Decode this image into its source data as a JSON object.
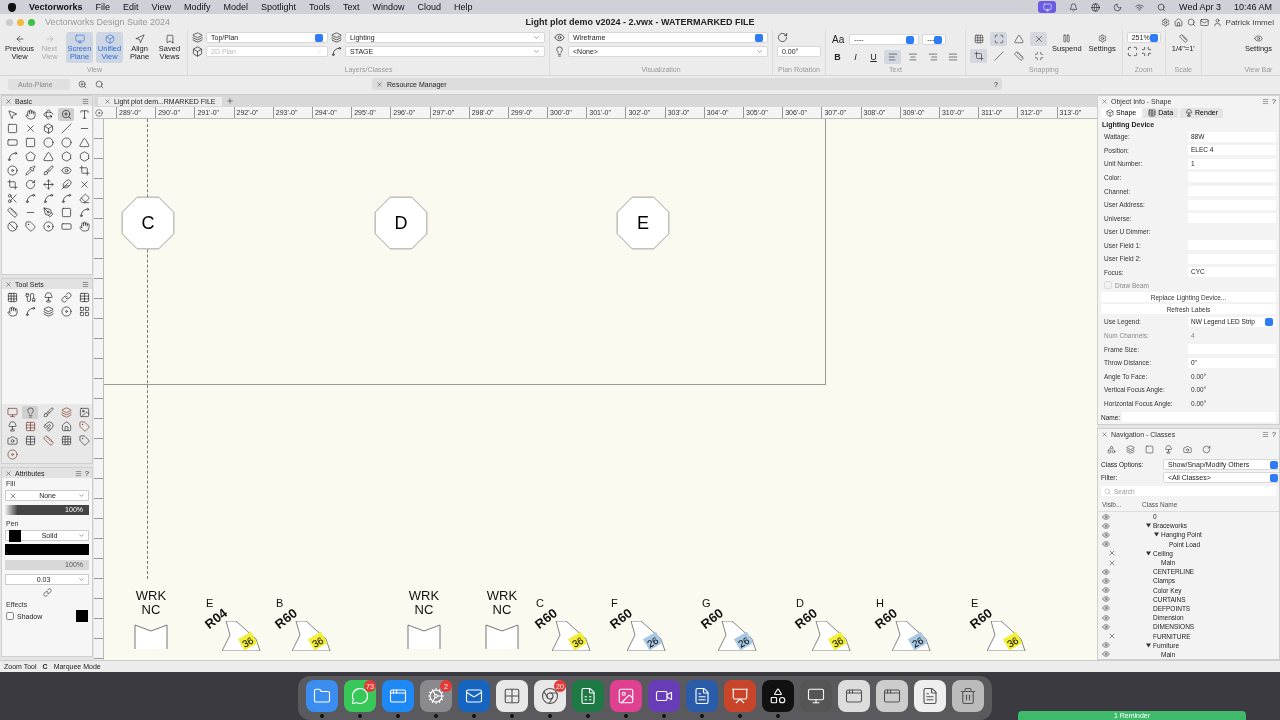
{
  "menu_bar": {
    "app": "Vectorworks",
    "menus": [
      "File",
      "Edit",
      "View",
      "Modify",
      "Model",
      "Spotlight",
      "Tools",
      "Text",
      "Window",
      "Cloud",
      "Help"
    ],
    "date": "Wed Apr 3",
    "time": "10:46 AM"
  },
  "window": {
    "app_title": "Vectorworks Design Suite 2024",
    "title": "Light plot demo v2024 - 2.vwx - WATERMARKED FILE",
    "user": "Patrick Immel"
  },
  "toolbar": {
    "view_buttons": [
      {
        "label": "Previous View",
        "selected": false,
        "disabled": false
      },
      {
        "label": "Next View",
        "selected": false,
        "disabled": true
      },
      {
        "label": "Screen Plane",
        "selected": true,
        "disabled": false
      },
      {
        "label": "Unified View",
        "selected": true,
        "disabled": false
      },
      {
        "label": "Align Plane",
        "selected": false,
        "disabled": false
      },
      {
        "label": "Saved Views",
        "selected": false,
        "disabled": false
      }
    ],
    "view_group": "View",
    "view": "Top/Plan",
    "render": {
      "value": "2D Plan",
      "disabled": true
    },
    "layer": "Lighting",
    "class": "STAGE",
    "layers_group": "Layers/Classes",
    "render_mode": "Wireframe",
    "light_option": "<None>",
    "visualization_group": "Visualization",
    "plan_rotation": "0.00°",
    "plan_rotation_group": "Plan Rotation",
    "font_button": "Aa",
    "font": "----",
    "font_size": "---",
    "text_styles": [
      "B",
      "I",
      "U"
    ],
    "alignments": [
      {
        "selected": true
      },
      {
        "selected": false
      },
      {
        "selected": false
      },
      {
        "selected": false
      }
    ],
    "text_group": "Text",
    "snaps": [
      {
        "selected": false
      },
      {
        "selected": true
      },
      {
        "selected": false
      },
      {
        "selected": true
      },
      {
        "selected": true
      },
      {
        "selected": false
      },
      {
        "selected": false
      },
      {
        "selected": false
      }
    ],
    "suspend": "Suspend",
    "snap_settings": "Settings",
    "snapping_group": "Snapping",
    "zoom": "251%",
    "zoom_group": "Zoom",
    "scale": "1/4\"=1'",
    "scale_group": "Scale",
    "view_bar_settings": "Settings",
    "view_bar_group": "View Bar"
  },
  "secondary_bar": {
    "auto_plane": "Auto-Plane",
    "resource_manager": "Resource Manager",
    "help": "?"
  },
  "basic_palette": {
    "title": "Basic",
    "tools": [
      {
        "selected": false
      },
      {
        "selected": false
      },
      {
        "selected": false
      },
      {
        "selected": true
      },
      {
        "selected": false
      },
      {
        "selected": false
      },
      {
        "selected": false
      },
      {
        "selected": false
      },
      {
        "selected": false
      },
      {
        "selected": false
      },
      {
        "selected": false
      },
      {
        "selected": false
      },
      {
        "selected": false
      },
      {
        "selected": false
      },
      {
        "selected": false
      },
      {
        "selected": false
      },
      {
        "selected": false
      },
      {
        "selected": false
      },
      {
        "selected": false
      },
      {
        "selected": false
      },
      {
        "selected": false
      },
      {
        "selected": false
      },
      {
        "selected": false
      },
      {
        "selected": false
      },
      {
        "selected": false
      },
      {
        "selected": false
      },
      {
        "selected": false
      },
      {
        "selected": false
      },
      {
        "selected": false
      },
      {
        "selected": false
      },
      {
        "selected": false
      },
      {
        "selected": false
      },
      {
        "selected": false
      },
      {
        "selected": false
      },
      {
        "selected": false
      },
      {
        "selected": false
      },
      {
        "selected": false
      },
      {
        "selected": false
      },
      {
        "selected": false
      },
      {
        "selected": false
      },
      {
        "selected": false
      },
      {
        "selected": false
      },
      {
        "selected": false
      },
      {
        "selected": false
      },
      {
        "selected": false
      }
    ]
  },
  "tool_sets": {
    "title": "Tool Sets",
    "tools": [
      {
        "selected": false
      },
      {
        "selected": false
      },
      {
        "selected": false
      },
      {
        "selected": false
      },
      {
        "selected": false
      },
      {
        "selected": false
      },
      {
        "selected": false
      },
      {
        "selected": false
      },
      {
        "selected": false
      },
      {
        "selected": false
      }
    ],
    "sets": [
      {
        "selected": false
      },
      {
        "selected": true
      },
      {
        "selected": false
      },
      {
        "selected": false
      },
      {
        "selected": false
      },
      {
        "selected": false
      },
      {
        "selected": false
      },
      {
        "selected": false
      },
      {
        "selected": false
      },
      {
        "selected": false
      },
      {
        "selected": false
      },
      {
        "selected": false
      },
      {
        "selected": false
      },
      {
        "selected": false
      },
      {
        "selected": false
      },
      {
        "selected": false
      }
    ]
  },
  "attributes": {
    "title": "Attributes",
    "help": "?",
    "fill_label": "Fill",
    "fill": "None",
    "fill_opacity": "100%",
    "pen_label": "Pen",
    "pen": "Solid",
    "pen_opacity": "100%",
    "line_weight": "0.03",
    "effects_label": "Effects",
    "shadow": "Shadow",
    "shadow_checked": false
  },
  "document": {
    "tab": "Light plot dem...RMARKED FILE",
    "ruler": [
      "289'-0\"",
      "290'-0\"",
      "291'-0\"",
      "292'-0\"",
      "293'-0\"",
      "294'-0\"",
      "295'-0\"",
      "296'-0\"",
      "297'-0\"",
      "298'-0\"",
      "299'-0\"",
      "300'-0\"",
      "301'-0\"",
      "302'-0\"",
      "303'-0\"",
      "304'-0\"",
      "305'-0\"",
      "306'-0\"",
      "307'-0\"",
      "308'-0\"",
      "309'-0\"",
      "310'-0\"",
      "311'-0\"",
      "312'-0\"",
      "313'-0\""
    ],
    "positions": [
      "C",
      "D",
      "E"
    ],
    "instruments": [
      {
        "kind": "work_light",
        "line1": "WRK",
        "line2": "NC"
      },
      {
        "kind": "fixture",
        "letter": "E",
        "code": "R04",
        "number": "36",
        "color": "#f2ee3a"
      },
      {
        "kind": "fixture",
        "letter": "B",
        "code": "R60",
        "number": "36",
        "color": "#f2ee3a"
      },
      {
        "kind": "work_light",
        "line1": "WRK",
        "line2": "NC"
      },
      {
        "kind": "work_light",
        "line1": "WRK",
        "line2": "NC"
      },
      {
        "kind": "fixture",
        "letter": "C",
        "code": "R60",
        "number": "36",
        "color": "#f2ee3a"
      },
      {
        "kind": "fixture",
        "letter": "F",
        "code": "R60",
        "number": "26",
        "color": "#a9c8e4"
      },
      {
        "kind": "fixture",
        "letter": "G",
        "code": "R60",
        "number": "26",
        "color": "#a9c8e4"
      },
      {
        "kind": "fixture",
        "letter": "D",
        "code": "R60",
        "number": "36",
        "color": "#f2ee3a"
      },
      {
        "kind": "fixture",
        "letter": "H",
        "code": "R60",
        "number": "26",
        "color": "#a9c8e4"
      },
      {
        "kind": "fixture",
        "letter": "E",
        "code": "R60",
        "number": "36",
        "color": "#f2ee3a"
      }
    ]
  },
  "object_info": {
    "title": "Object Info - Shape",
    "help": "?",
    "tabs": [
      {
        "label": "Shape",
        "selected": true
      },
      {
        "label": "Data",
        "selected": false
      },
      {
        "label": "Render",
        "selected": false
      }
    ],
    "heading": "Lighting Device",
    "rows": [
      {
        "kind": "field",
        "label": "Wattage:",
        "value": "88W"
      },
      {
        "kind": "field",
        "label": "Position:",
        "value": "ELEC 4"
      },
      {
        "kind": "field",
        "label": "Unit Number:",
        "value": "1"
      },
      {
        "kind": "field",
        "label": "Color:"
      },
      {
        "kind": "field",
        "label": "Channel:"
      },
      {
        "kind": "field",
        "label": "User Address:"
      },
      {
        "kind": "field",
        "label": "Universe:"
      },
      {
        "kind": "text",
        "label": "User U Dimmer:"
      },
      {
        "kind": "field",
        "label": "User Field 1:"
      },
      {
        "kind": "field",
        "label": "User Field 2:"
      },
      {
        "kind": "field",
        "label": "Focus:",
        "value": "CYC"
      },
      {
        "kind": "checkbox",
        "label": "Draw Beam",
        "checked": false,
        "disabled": true
      },
      {
        "kind": "button",
        "label": "Replace Lighting Device..."
      },
      {
        "kind": "button",
        "label": "Refresh Labels"
      },
      {
        "kind": "dropdown",
        "label": "Use Legend:",
        "value": "NW Legend LED Strip"
      },
      {
        "kind": "disabled",
        "label": "Num Channels:",
        "value": "4"
      },
      {
        "kind": "field",
        "label": "Frame Size:"
      },
      {
        "kind": "field",
        "label": "Throw Distance:",
        "value": "0\""
      },
      {
        "kind": "text",
        "label": "Angle To Face:",
        "value": "0.00°"
      },
      {
        "kind": "text",
        "label": "Vertical Focus Angle:",
        "value": "0.00°"
      },
      {
        "kind": "text",
        "label": "Horizontal Focus Angle:",
        "value": "0.00°"
      }
    ],
    "name_label": "Name:"
  },
  "navigation": {
    "title": "Navigation - Classes",
    "help": "?",
    "class_options_label": "Class Options:",
    "class_options": "Show/Snap/Modify Others",
    "filter_label": "Filter:",
    "filter": "<All Classes>",
    "search_placeholder": "Search",
    "columns": [
      "Visib...",
      "Class Name"
    ],
    "classes": [
      {
        "name": "0",
        "visible": true
      },
      {
        "name": "Braceworks",
        "visible": true,
        "expanded": true,
        "children": [
          {
            "name": "Hanging Point",
            "visible": true,
            "expanded": true,
            "children": [
              {
                "name": "Point Load",
                "visible": true
              }
            ]
          }
        ]
      },
      {
        "name": "Ceiling",
        "visible": false,
        "expanded": true,
        "children": [
          {
            "name": "Main",
            "visible": false
          }
        ]
      },
      {
        "name": "CENTERLINE",
        "visible": true
      },
      {
        "name": "Clamps",
        "visible": true
      },
      {
        "name": "Color Key",
        "visible": true
      },
      {
        "name": "CURTAINS",
        "visible": true
      },
      {
        "name": "DEFPOINTS",
        "visible": true
      },
      {
        "name": "Dimension",
        "visible": true
      },
      {
        "name": "DIMENSIONS",
        "visible": true
      },
      {
        "name": "FURNITURE",
        "visible": false
      },
      {
        "name": "Furniture",
        "visible": true,
        "expanded": true,
        "children": [
          {
            "name": "Main",
            "visible": true
          }
        ]
      }
    ]
  },
  "status_bar": {
    "tool": "Zoom Tool",
    "mode_key": "C",
    "mode": "Marquee Mode"
  },
  "dock": [
    {
      "running": true
    },
    {
      "running": true,
      "badge": "73"
    },
    {
      "running": true
    },
    {
      "running": true,
      "badge": "2"
    },
    {
      "running": true
    },
    {
      "running": true
    },
    {
      "running": true,
      "badge": "20"
    },
    {
      "running": true
    },
    {
      "running": true
    },
    {
      "running": true
    },
    {
      "running": true
    },
    {
      "running": true
    },
    {
      "running": true
    },
    {
      "running": false
    },
    {
      "running": false
    },
    {
      "running": false
    },
    {
      "running": false
    },
    {
      "running": false
    }
  ],
  "notification": {
    "title": "1 Reminder"
  }
}
